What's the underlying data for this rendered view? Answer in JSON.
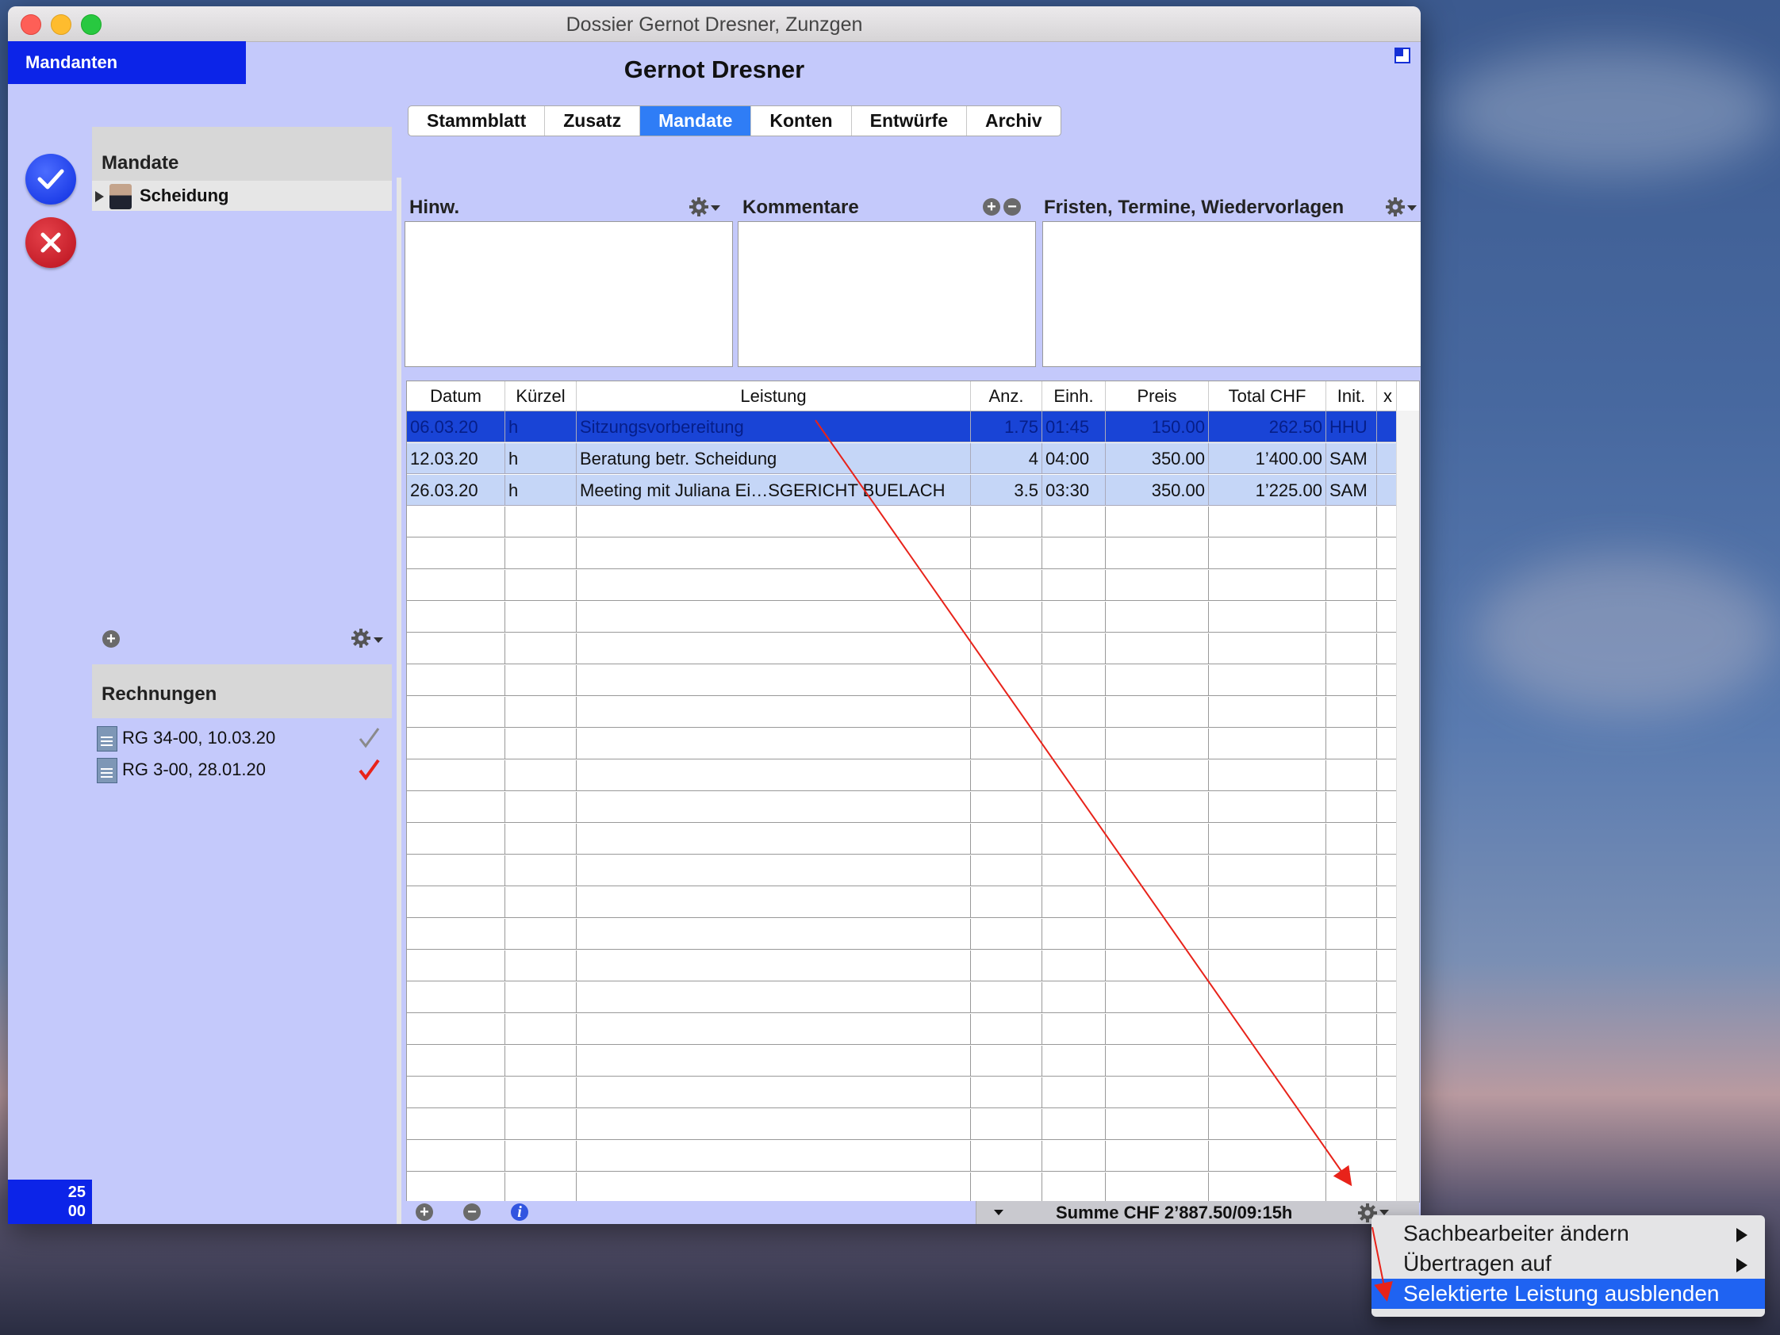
{
  "window": {
    "title": "Dossier Gernot Dresner, Zunzgen",
    "client_name": "Gernot Dresner",
    "mandanten_label": "Mandanten",
    "counter_top": "25",
    "counter_bottom": "00"
  },
  "tabs": [
    "Stammblatt",
    "Zusatz",
    "Mandate",
    "Konten",
    "Entwürfe",
    "Archiv"
  ],
  "active_tab": "Mandate",
  "mandates": {
    "title": "Mandate",
    "items": [
      {
        "label": "Scheidung"
      }
    ]
  },
  "invoices": {
    "title": "Rechnungen",
    "items": [
      {
        "label": "RG 34-00, 10.03.20",
        "check_color": "#8a8a8a"
      },
      {
        "label": "RG 3-00, 28.01.20",
        "check_color": "#e8231a"
      }
    ]
  },
  "panels": {
    "hinw": "Hinw.",
    "kommentare": "Kommentare",
    "fristen": "Fristen, Termine, Wiedervorlagen"
  },
  "table": {
    "columns": [
      "Datum",
      "Kürzel",
      "Leistung",
      "Anz.",
      "Einh.",
      "Preis",
      "Total CHF",
      "Init.",
      "x"
    ],
    "rows": [
      [
        "06.03.20",
        "h",
        "Sitzungsvorbereitung",
        "1.75",
        "01:45",
        "150.00",
        "262.50",
        "HHU",
        ""
      ],
      [
        "12.03.20",
        "h",
        "Beratung betr. Scheidung",
        "4",
        "04:00",
        "350.00",
        "1’400.00",
        "SAM",
        ""
      ],
      [
        "26.03.20",
        "h",
        "Meeting mit Juliana Ei…SGERICHT BUELACH",
        "3.5",
        "03:30",
        "350.00",
        "1’225.00",
        "SAM",
        ""
      ]
    ],
    "selected_row": 0
  },
  "footer": {
    "sum": "Summe CHF 2’887.50/09:15h"
  },
  "context_menu": {
    "items": [
      {
        "label": "Sachbearbeiter ändern",
        "submenu": true
      },
      {
        "label": "Übertragen auf",
        "submenu": true
      },
      {
        "label": "Selektierte Leistung ausblenden",
        "submenu": false
      }
    ],
    "highlighted": 2
  },
  "colors": {
    "window_bg": "#c4c9fb",
    "accent_blue": "#0c24e8",
    "tab_active": "#2f7df6",
    "row_selected": "#1944d6",
    "row_alt": "#c5d6f7",
    "annotation_arrow": "#e8231a"
  }
}
